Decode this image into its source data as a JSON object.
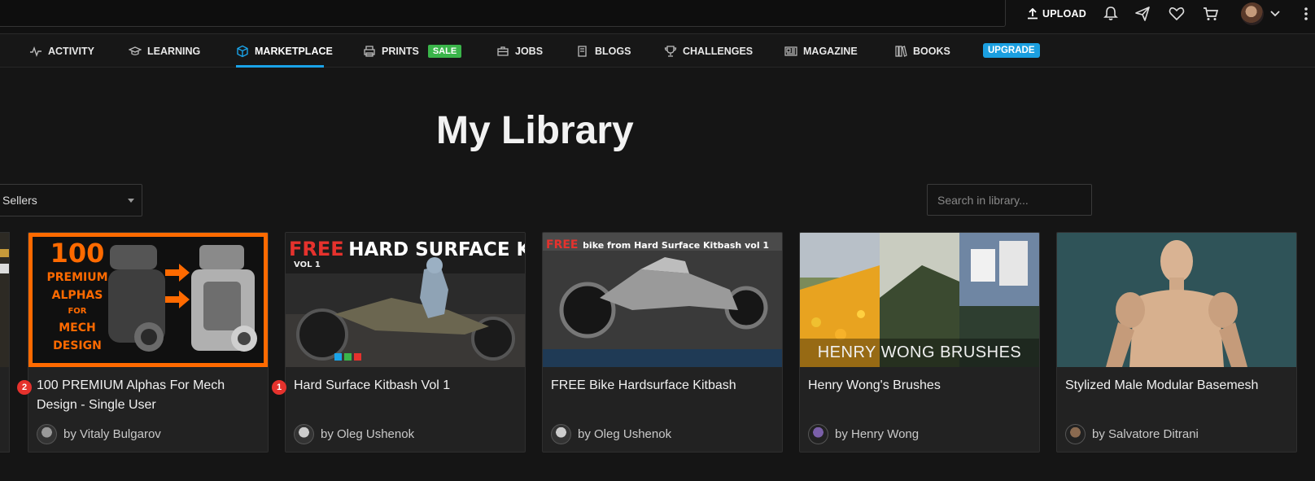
{
  "topbar": {
    "upload_label": "UPLOAD",
    "icons": [
      "upload-icon",
      "bell-icon",
      "send-icon",
      "heart-icon",
      "cart-icon",
      "avatar",
      "chevron-down-icon",
      "more-vertical-icon"
    ]
  },
  "nav": {
    "items": [
      {
        "label": "ACTIVITY",
        "icon": "activity-icon"
      },
      {
        "label": "LEARNING",
        "icon": "graduation-cap-icon"
      },
      {
        "label": "MARKETPLACE",
        "icon": "cube-icon",
        "active": true
      },
      {
        "label": "PRINTS",
        "icon": "printer-icon",
        "badge": "SALE"
      },
      {
        "label": "JOBS",
        "icon": "briefcase-icon"
      },
      {
        "label": "BLOGS",
        "icon": "book-icon"
      },
      {
        "label": "CHALLENGES",
        "icon": "trophy-icon"
      },
      {
        "label": "MAGAZINE",
        "icon": "newspaper-icon"
      },
      {
        "label": "BOOKS",
        "icon": "books-icon"
      }
    ],
    "upgrade_label": "UPGRADE"
  },
  "page": {
    "title": "My Library"
  },
  "filters": {
    "sellers_value": "Sellers",
    "search_placeholder": "Search in library..."
  },
  "products": [
    {
      "title": "100 PREMIUM Alphas For Mech Design - Single User",
      "seller": "by Vitaly Bulgarov",
      "badge": "2",
      "thumb_text": [
        "100",
        "PREMIUM",
        "ALPHAS",
        "FOR",
        "MECH",
        "DESIGN"
      ]
    },
    {
      "title": "Hard Surface Kitbash Vol 1",
      "seller": "by Oleg Ushenok",
      "badge": "1",
      "thumb_text": [
        "FREE",
        "HARD SURFACE KITBASH",
        "VOL 1"
      ]
    },
    {
      "title": "FREE Bike Hardsurface Kitbash",
      "seller": "by Oleg Ushenok",
      "thumb_text": [
        "FREE",
        "bike from Hard Surface Kitbash vol 1"
      ]
    },
    {
      "title": "Henry Wong's Brushes",
      "seller": "by Henry Wong",
      "thumb_text": [
        "HENRY WONG BRUSHES"
      ]
    },
    {
      "title": "Stylized Male Modular Basemesh",
      "seller": "by Salvatore Ditrani"
    }
  ],
  "colors": {
    "background": "#151515",
    "accent": "#1aa3e8",
    "sale": "#3ab54a",
    "notification": "#e5322d",
    "orange": "#ff6a00"
  }
}
